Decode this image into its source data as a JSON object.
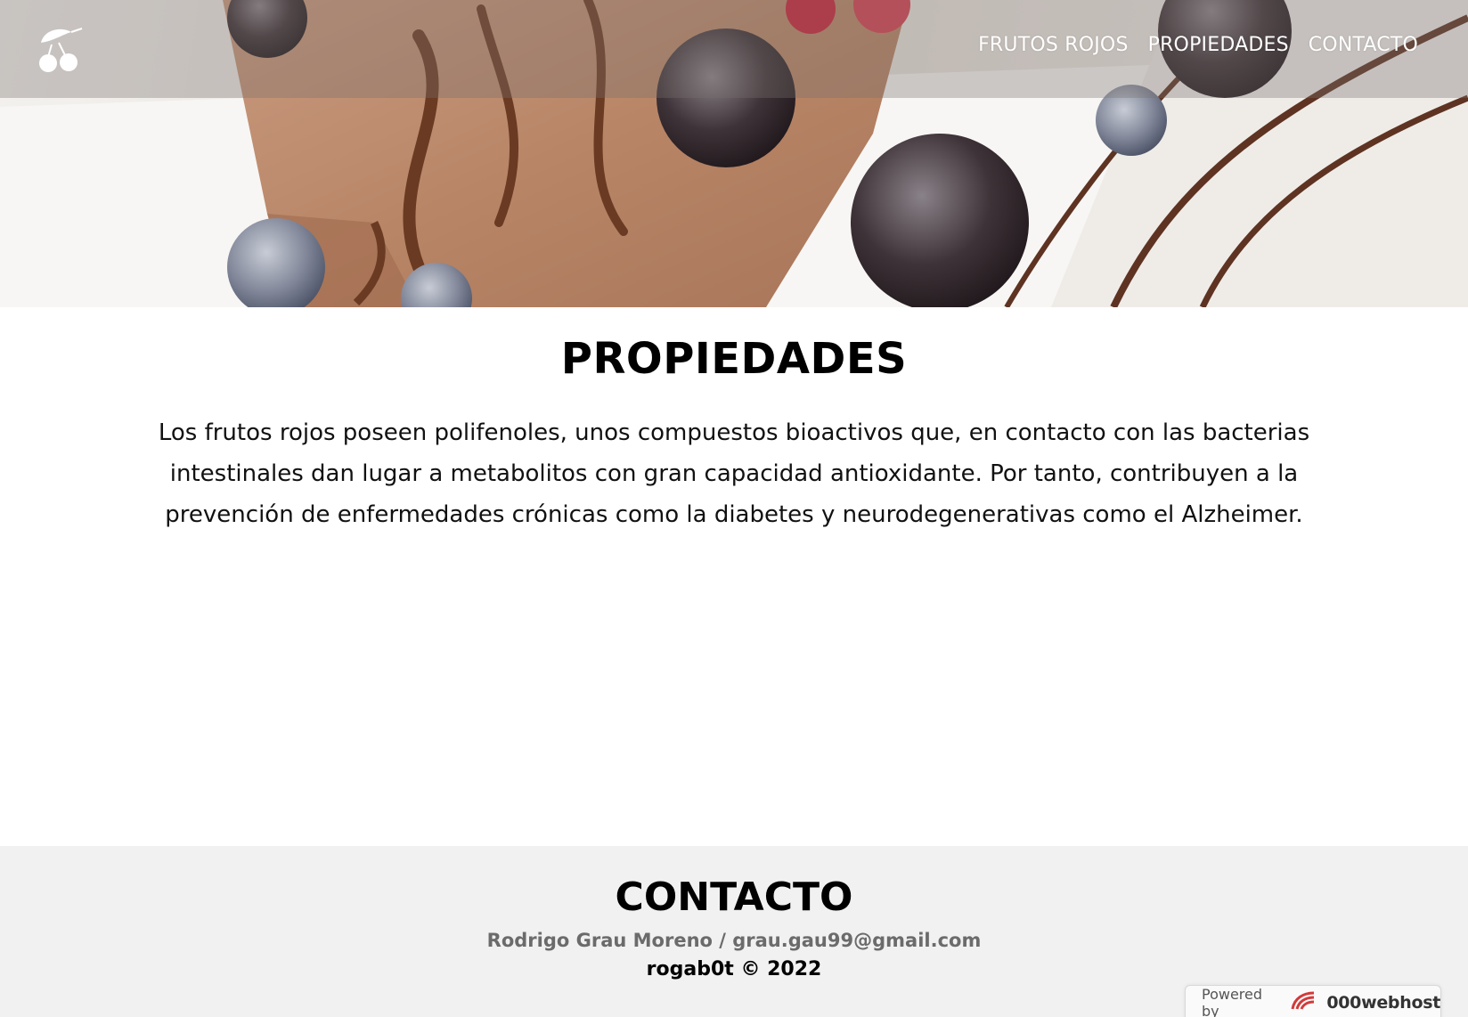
{
  "header": {
    "logo_icon": "cherries-logo-icon",
    "nav": [
      {
        "label": "FRUTOS ROJOS"
      },
      {
        "label": "PROPIEDADES"
      },
      {
        "label": "CONTACTO"
      }
    ]
  },
  "main": {
    "title": "PROPIEDADES",
    "text": "Los frutos rojos poseen polifenoles, unos compuestos bioactivos que, en contacto con las bacterias intestinales dan lugar a metabolitos con gran capacidad antioxidante. Por tanto, contribuyen a la prevención de enfermedades crónicas como la diabetes y neurodegenerativas como el Alzheimer."
  },
  "footer": {
    "title": "CONTACTO",
    "contact": "Rodrigo Grau Moreno / grau.gau99@gmail.com",
    "copyright": "rogab0t © 2022"
  },
  "badge": {
    "label": "Powered by",
    "brand": "000webhost",
    "icon": "000webhost-logo-icon"
  },
  "colors": {
    "footer_bg": "#f1f1f1",
    "nav_text": "#ffffff",
    "contact_text": "#6b6b6b"
  }
}
